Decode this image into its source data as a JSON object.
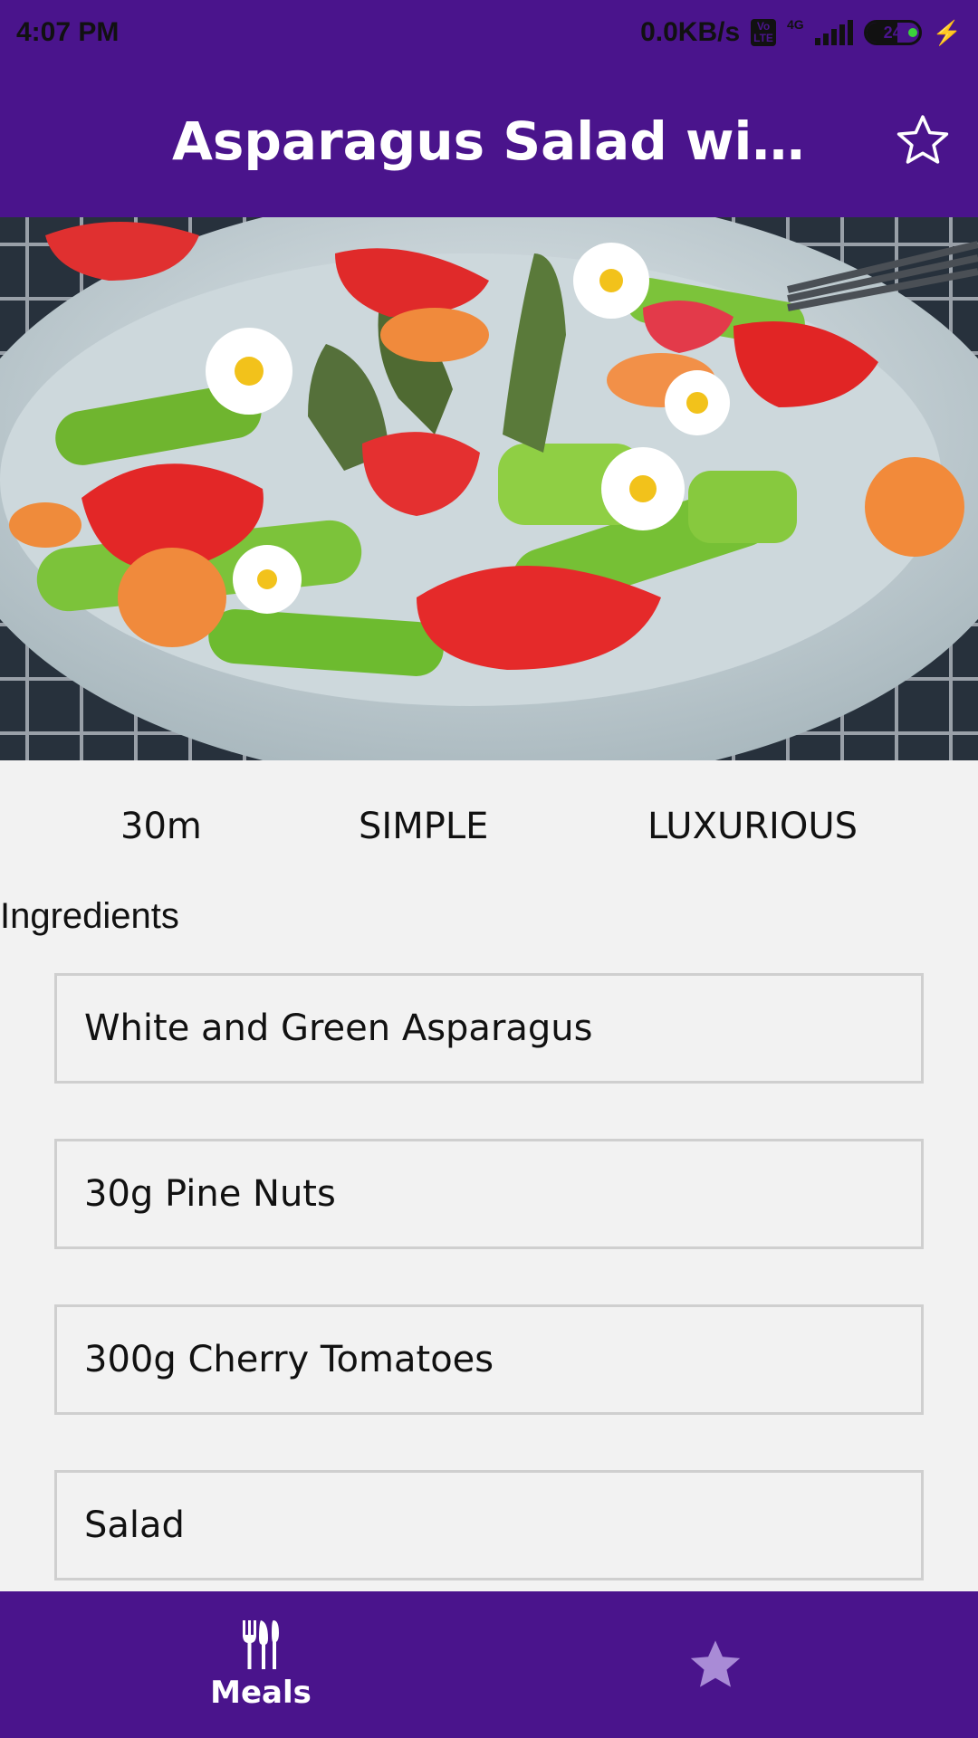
{
  "status_bar": {
    "time": "4:07 PM",
    "network_speed": "0.0KB/s",
    "volte_label": "Vo LTE",
    "network_type": "4G",
    "battery": "24",
    "icons": [
      "volte-icon",
      "signal-icon",
      "battery-icon",
      "charging-icon"
    ]
  },
  "header": {
    "title": "Asparagus Salad with Cherry Tomatoes",
    "favorite_icon": "star-outline-icon"
  },
  "meal": {
    "image_alt": "salad with asparagus, strawberries, carrots and daisies",
    "duration": "30m",
    "complexity": "SIMPLE",
    "affordability": "LUXURIOUS"
  },
  "ingredients": {
    "title": "Ingredients",
    "items": [
      "White and Green Asparagus",
      "30g Pine Nuts",
      "300g Cherry Tomatoes",
      "Salad"
    ]
  },
  "bottom_nav": {
    "meals_label": "Meals",
    "meals_icon": "fork-knife-icon",
    "favorites_icon": "star-icon"
  },
  "colors": {
    "primary": "#4a148c",
    "background": "#f2f2f2",
    "inactive_nav": "#a98bd6"
  }
}
